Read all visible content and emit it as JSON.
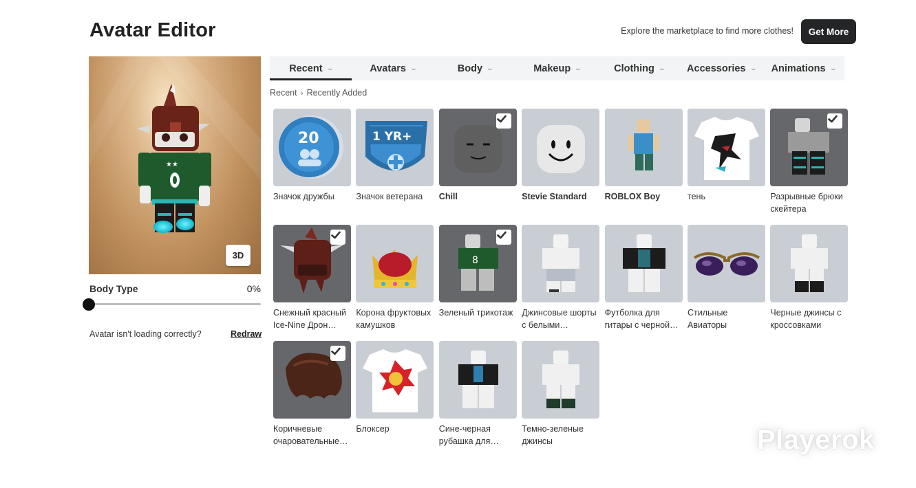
{
  "header": {
    "title": "Avatar Editor",
    "promo_text": "Explore the marketplace to find more clothes!",
    "get_more_label": "Get More"
  },
  "preview": {
    "view_toggle_label": "3D",
    "body_type_label": "Body Type",
    "body_type_value": "0%",
    "body_type_fraction": 0,
    "loading_text": "Avatar isn't loading correctly?",
    "redraw_label": "Redraw"
  },
  "tabs": [
    {
      "label": "Recent",
      "active": true
    },
    {
      "label": "Avatars"
    },
    {
      "label": "Body"
    },
    {
      "label": "Makeup"
    },
    {
      "label": "Clothing"
    },
    {
      "label": "Accessories"
    },
    {
      "label": "Animations"
    }
  ],
  "breadcrumb": [
    "Recent",
    "Recently Added"
  ],
  "items": [
    {
      "name": "Значок дружбы",
      "icon": "friendship-badge-icon",
      "equipped": false,
      "dark": false,
      "bold": false
    },
    {
      "name": "Значок ветерана",
      "icon": "veteran-badge-icon",
      "equipped": false,
      "dark": false,
      "bold": false
    },
    {
      "name": "Chill",
      "icon": "chill-face-icon",
      "equipped": true,
      "dark": true,
      "bold": true
    },
    {
      "name": "Stevie Standard",
      "icon": "standard-face-icon",
      "equipped": false,
      "dark": false,
      "bold": true
    },
    {
      "name": "ROBLOX Boy",
      "icon": "roblox-boy-icon",
      "equipped": false,
      "dark": false,
      "bold": true
    },
    {
      "name": "тень",
      "icon": "shadow-tshirt-icon",
      "equipped": false,
      "dark": false,
      "bold": false
    },
    {
      "name": "Разрывные брюки скейтера",
      "icon": "skater-pants-icon",
      "equipped": true,
      "dark": true,
      "bold": false
    },
    {
      "name": "Снежный красный Ice-Nine Дрон…",
      "icon": "ice-nine-helmet-icon",
      "equipped": true,
      "dark": true,
      "bold": false
    },
    {
      "name": "Корона фруктовых камушков",
      "icon": "crown-icon",
      "equipped": false,
      "dark": false,
      "bold": false
    },
    {
      "name": "Зеленый трикотаж",
      "icon": "green-jersey-icon",
      "equipped": true,
      "dark": true,
      "bold": false
    },
    {
      "name": "Джинсовые шорты с белыми…",
      "icon": "denim-shorts-icon",
      "equipped": false,
      "dark": false,
      "bold": false
    },
    {
      "name": "Футболка для гитары с черной…",
      "icon": "guitar-shirt-icon",
      "equipped": false,
      "dark": false,
      "bold": false
    },
    {
      "name": "Стильные Авиаторы",
      "icon": "aviator-sunglasses-icon",
      "equipped": false,
      "dark": false,
      "bold": false
    },
    {
      "name": "Черные джинсы с кроссовками",
      "icon": "black-jeans-icon",
      "equipped": false,
      "dark": false,
      "bold": false
    },
    {
      "name": "Коричневые очаровательные…",
      "icon": "brown-hair-icon",
      "equipped": true,
      "dark": true,
      "bold": false
    },
    {
      "name": "Блоксер",
      "icon": "blokser-tshirt-icon",
      "equipped": false,
      "dark": false,
      "bold": false
    },
    {
      "name": "Сине-черная рубашка для…",
      "icon": "blue-black-shirt-icon",
      "equipped": false,
      "dark": false,
      "bold": false
    },
    {
      "name": "Темно-зеленые джинсы",
      "icon": "dark-green-jeans-icon",
      "equipped": false,
      "dark": false,
      "bold": false
    }
  ],
  "watermark": "Playerok"
}
